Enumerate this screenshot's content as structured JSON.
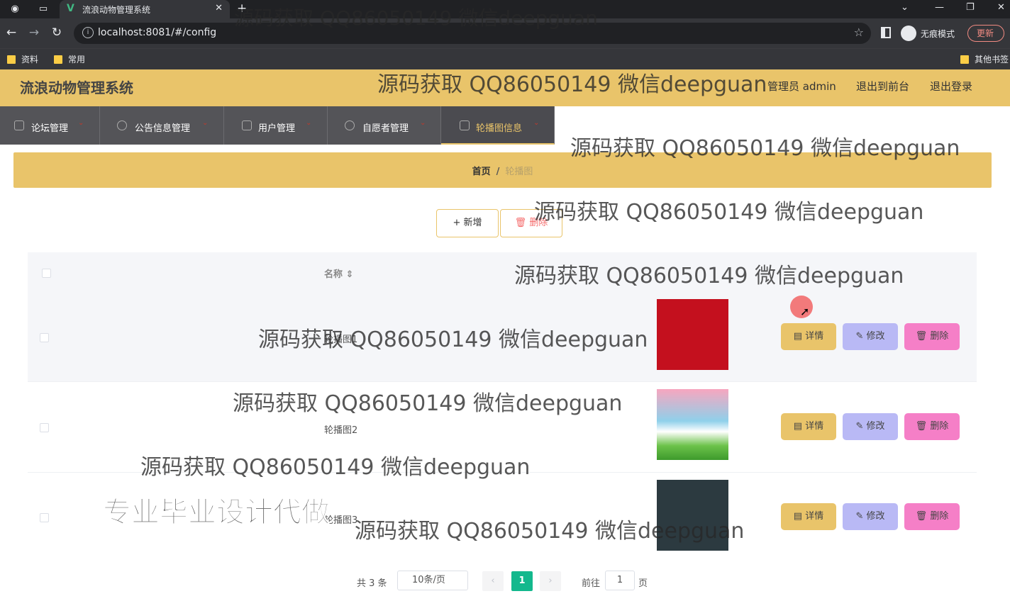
{
  "browser": {
    "tab_title": "流浪动物管理系统",
    "url": "localhost:8081/#/config",
    "incognito_label": "无痕模式",
    "update_label": "更新",
    "bookmarks": [
      "资料",
      "常用"
    ],
    "other_bookmarks": "其他书签"
  },
  "header": {
    "title": "流浪动物管理系统",
    "user": "管理员 admin",
    "to_front": "退出到前台",
    "logout": "退出登录"
  },
  "menu": [
    {
      "label": "论坛管理",
      "icon": "forum-icon"
    },
    {
      "label": "公告信息管理",
      "icon": "notice-icon"
    },
    {
      "label": "用户管理",
      "icon": "user-icon"
    },
    {
      "label": "自愿者管理",
      "icon": "volunteer-icon"
    },
    {
      "label": "轮播图信息",
      "icon": "carousel-icon"
    }
  ],
  "breadcrumb": {
    "home": "首页",
    "separator": "/",
    "current": "轮播图"
  },
  "toolbar": {
    "add_label": "新增",
    "delete_label": "删除"
  },
  "table": {
    "col_name": "名称",
    "rows": [
      {
        "name": "轮播图1",
        "image_color": "#c4101e"
      },
      {
        "name": "轮播图2",
        "image_color": "#8fd0ea"
      },
      {
        "name": "轮播图3",
        "image_color": "#2c3a40"
      }
    ],
    "actions": {
      "detail": "详情",
      "edit": "修改",
      "remove": "删除"
    }
  },
  "pagination": {
    "total": "共 3 条",
    "page_size": "10条/页",
    "current": "1",
    "goto_label": "前往",
    "goto_value": "1",
    "page_suffix": "页"
  },
  "watermarks": {
    "text": "源码获取 QQ86050149 微信deepguan",
    "big": "专业毕业设计代做"
  },
  "colors": {
    "accent": "#e9c46a",
    "menu_bg": "#545458",
    "pager_active": "#13b88d"
  }
}
